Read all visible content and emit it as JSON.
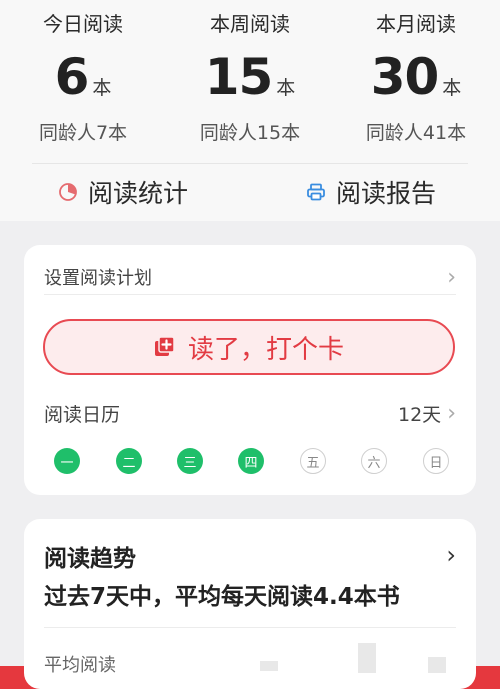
{
  "stats": [
    {
      "label": "今日阅读",
      "value": "6",
      "unit": "本",
      "peer": "同龄人7本"
    },
    {
      "label": "本周阅读",
      "value": "15",
      "unit": "本",
      "peer": "同龄人15本"
    },
    {
      "label": "本月阅读",
      "value": "30",
      "unit": "本",
      "peer": "同龄人41本"
    }
  ],
  "actions": {
    "stats_label": "阅读统计",
    "report_label": "阅读报告"
  },
  "plan": {
    "label": "设置阅读计划",
    "chevron": "›"
  },
  "checkin": {
    "label": "读了，打个卡"
  },
  "calendar": {
    "label": "阅读日历",
    "count": "12天",
    "chevron": "›"
  },
  "weekdays": [
    {
      "label": "一",
      "done": true
    },
    {
      "label": "二",
      "done": true
    },
    {
      "label": "三",
      "done": true
    },
    {
      "label": "四",
      "done": true
    },
    {
      "label": "五",
      "done": false
    },
    {
      "label": "六",
      "done": false
    },
    {
      "label": "日",
      "done": false
    }
  ],
  "trend": {
    "title": "阅读趋势",
    "subtitle": "过去7天中，平均每天阅读4.4本书",
    "chevron": "›",
    "avg_label": "平均阅读"
  },
  "colors": {
    "accent_red": "#e23b43",
    "done_green": "#1fbf6a",
    "background_red": "#e5383e"
  }
}
